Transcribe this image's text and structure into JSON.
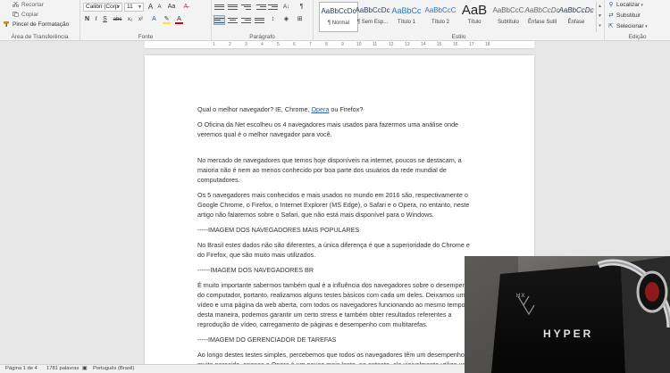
{
  "ribbon": {
    "clipboard": {
      "items": [
        "Recortar",
        "Copiar",
        "Pincel de Formatação"
      ],
      "group_label": "Área de Transferência"
    },
    "font": {
      "family": "Calibri (Corp",
      "size": "11",
      "group_label": "Fonte",
      "buttons": [
        "A",
        "A",
        "Aa",
        "N",
        "I",
        "S",
        "abc",
        "x₂",
        "x²",
        "A",
        "A"
      ]
    },
    "paragraph": {
      "group_label": "Parágrafo",
      "pilcrow": "¶"
    },
    "styles": {
      "group_label": "Estilo",
      "tiles": [
        {
          "preview": "AaBbCcDc",
          "name": "¶ Normal"
        },
        {
          "preview": "AaBbCcDc",
          "name": "¶ Sem Esp..."
        },
        {
          "preview": "AaBbCc",
          "name": "Título 1"
        },
        {
          "preview": "AaBbCcC",
          "name": "Título 2"
        },
        {
          "preview": "AaB",
          "name": "Título"
        },
        {
          "preview": "AaBbCcC",
          "name": "Subtítulo"
        },
        {
          "preview": "AaBbCcDc",
          "name": "Ênfase Sutil"
        },
        {
          "preview": "AaBbCcDc",
          "name": "Ênfase"
        }
      ]
    },
    "editing": {
      "group_label": "Edição",
      "items": [
        "Localizar",
        "Substituir",
        "Selecionar"
      ]
    }
  },
  "ruler": {
    "numbers": [
      "1",
      "2",
      "3",
      "4",
      "5",
      "6",
      "7",
      "8",
      "9",
      "10",
      "11",
      "12",
      "13",
      "14",
      "15",
      "16",
      "17",
      "18"
    ]
  },
  "document": {
    "title_line": {
      "before": "Qual o melhor navegador? IE, Chrome, ",
      "link": "Opera",
      "after": " ou Firefox?"
    },
    "paragraphs": [
      "O Oficina da Net escolheu os 4 navegadores mais usados para fazermos uma análise onde veremos qual é o melhor navegador para você.",
      "No mercado de navegadores que temos hoje disponíveis na internet, poucos se destacam, a maioria não é nem ao menos conhecido por boa parte dos usuários da rede mundial de computadores.",
      "Os 5 navegadores mais conhecidos e mais usados no mundo em 2016 são, respectivamente o Google Chrome, o Firefox, o Internet Explorer (MS Edge), o Safari e o Opera, no entanto, neste artigo não falaremos sobre o Safari, que não está mais disponível para o Windows.",
      "-----IMAGEM DOS NAVEGADORES MAIS POPULARES",
      "No Brasil estes dados não são diferentes, a única diferença é que a superioridade do Chrome e do Firefox, que são muito mais utilizados.",
      "------IMAGEM DOS NAVEGADORES BR",
      "É muito importante sabermos também qual é a influência dos navegadores sobre o desempenho do computador, portanto, realizamos alguns testes básicos com cada um deles. Deixamos um vídeo e uma página da web aberta, com todos os navegadores funcionando ao mesmo tempo, desta maneira, podemos garantir um certo stress e também obter resultados referentes a reprodução de vídeo, carregamento de páginas e desempenho com multitarefas.",
      "-----IMAGEM DO GERENCIADOR DE TAREFAS",
      "Ao longo destes testes simples, percebemos que todos os navegadores têm um desempenho muito parecido, apenas o Opera é um pouco mais lento, no entanto, ele visivelmente utiliza uma porção muito menor dos recursos do computador."
    ]
  },
  "status_bar": {
    "page": "Página 1 de 4",
    "words": "1781 palavras",
    "language": "Português (Brasil)"
  },
  "webcam": {
    "brand_text": "HYPER",
    "brand_mark": "HX"
  },
  "colors": {
    "accent": "#2b579a",
    "link": "#2a5db0",
    "ribbon_bg": "#f3f3f3",
    "workspace": "#e6e6e6"
  }
}
